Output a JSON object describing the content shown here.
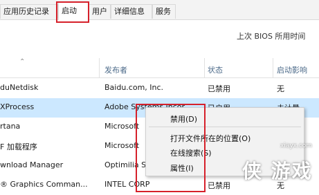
{
  "tabs": [
    {
      "label": "应用历史记录"
    },
    {
      "label": "启动"
    },
    {
      "label": "用户"
    },
    {
      "label": "详细信息"
    },
    {
      "label": "服务"
    }
  ],
  "bios_text": "上次 BIOS 所用时间",
  "columns": {
    "publisher": "发布者",
    "status": "状态",
    "impact": "启动影响"
  },
  "rows": [
    {
      "name": "duNetdisk",
      "publisher": "Baidu.com, Inc.",
      "status": "已禁用",
      "impact": "无"
    },
    {
      "name": "XProcess",
      "publisher": "Adobe Systems Incor",
      "status": "已启用",
      "impact": "未计量"
    },
    {
      "name": "rtana",
      "publisher": "Microsoft",
      "status": "",
      "impact": ""
    },
    {
      "name": "F 加载程序",
      "publisher": "Microsoft",
      "status": "",
      "impact": ""
    },
    {
      "name": "wnload Manager",
      "publisher": "Optimilia S",
      "status": "",
      "impact": ""
    },
    {
      "name": "® Graphics Comman...",
      "publisher": "INTEL CORP",
      "status": "已禁用",
      "impact": "无"
    }
  ],
  "context_menu": {
    "disable": "禁用(D)",
    "open_location": "打开文件所在的位置(O)",
    "search_online": "在线搜索(S)",
    "properties": "属性(I)"
  },
  "watermark": {
    "site": "xiayx.com",
    "brand": "侠 游戏"
  },
  "colors": {
    "highlight_border": "#d6202a",
    "selected_row": "#cce8ff",
    "header_text": "#4d6b8a"
  }
}
